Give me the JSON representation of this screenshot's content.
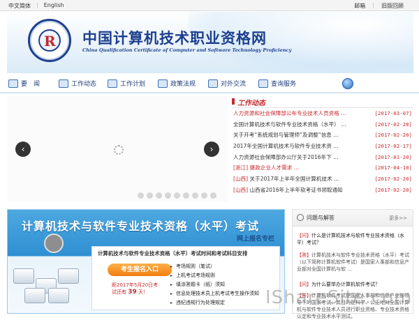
{
  "topbar": {
    "lang_zh": "中文简体",
    "lang_en": "English",
    "mail": "邮箱",
    "old_site": "旧版回顾"
  },
  "header": {
    "title": "中国计算机技术职业资格网",
    "subtitle": "China Qualification Certificate of Computer and Software Technology Proficiency"
  },
  "nav": {
    "items": [
      {
        "label": "要　闻"
      },
      {
        "label": "工作动态"
      },
      {
        "label": "工作计划"
      },
      {
        "label": "政策法规"
      },
      {
        "label": "对外交流"
      },
      {
        "label": "查询服务"
      }
    ]
  },
  "slider": {
    "prev": "‹",
    "next": "›",
    "dot_count": 9
  },
  "news": {
    "heading": "工作动态",
    "items": [
      {
        "title": "人力资源和社会保障部公布专业技术人员资格 ...",
        "date": "[2017-03-07]",
        "highlight": true
      },
      {
        "title": "全国计算机技术与软件专业技术资格（水平） ...",
        "date": "[2017-02-28]"
      },
      {
        "title": "关于开考“系统规划与管理师”及调整“信息 ...",
        "date": "[2017-02-20]"
      },
      {
        "title": "2017年全国计算机技术与软件专业技术资 ...",
        "date": "[2017-02-17]"
      },
      {
        "title": "人力资源社会保障部办公厅关于2016年下 ...",
        "date": "[2017-01-20]"
      },
      {
        "prov": "[浙江]",
        "title": "摄政企业人才需求 ...",
        "date": "[2017-04-10]",
        "highlight": true
      },
      {
        "prov": "[山西]",
        "title": "关于2017年上半年全国计算机技术 ...",
        "date": "[2017-02-20]"
      },
      {
        "prov": "[山西]",
        "title": "山西省2016年上半年软考证书领取通知",
        "date": "[2017-02-20]"
      }
    ]
  },
  "promo": {
    "title": "计算机技术与软件专业技术资格（水平）考试",
    "subtitle": "网上报名专栏",
    "box_heading": "计算机技术与软件专业技术资格（水平）考试时间和考试科目安排",
    "signup_button": "考生报名入口",
    "deadline_line1": "距2017年5月20日考",
    "deadline_line2": "试还有",
    "deadline_days": "39",
    "deadline_unit": "天！",
    "links": [
      "考场规则（笔试）",
      "上机考试考场规则",
      "填涂答题卡（纸）须知",
      "信息处理技术员上机考试考生操作须知",
      "违纪违规行为处理规定"
    ]
  },
  "faq": {
    "heading": "问题与解答",
    "more": "更多>>",
    "items": [
      {
        "tag": "【问】",
        "text": "什么是计算机技术与软件专业技术资格（水平）考试？"
      },
      {
        "tag": "【答】",
        "text": "计算机技术与软件专业技术资格（水平）考试（以下简称计算机软件考试）是国家人事部和信息产业部对全国计算机与软 ..."
      },
      {
        "tag": "【问】",
        "text": "为什么要举办计算机软件考试？"
      },
      {
        "tag": "【答】",
        "text": "计算机软件考试是国家人事部和信息产业部领导下的国家考试，其目的是科学、公正地对全国计算机与软件专业技术人员进行职业资格、专业技术资格认定和专业技术水平测试。"
      }
    ]
  },
  "watermark": "IShareSite.com",
  "colors": {
    "brand_blue": "#1d3f8e",
    "accent_red": "#c8282d",
    "promo_blue": "#2f8fd2",
    "button_orange": "#f07d10"
  }
}
